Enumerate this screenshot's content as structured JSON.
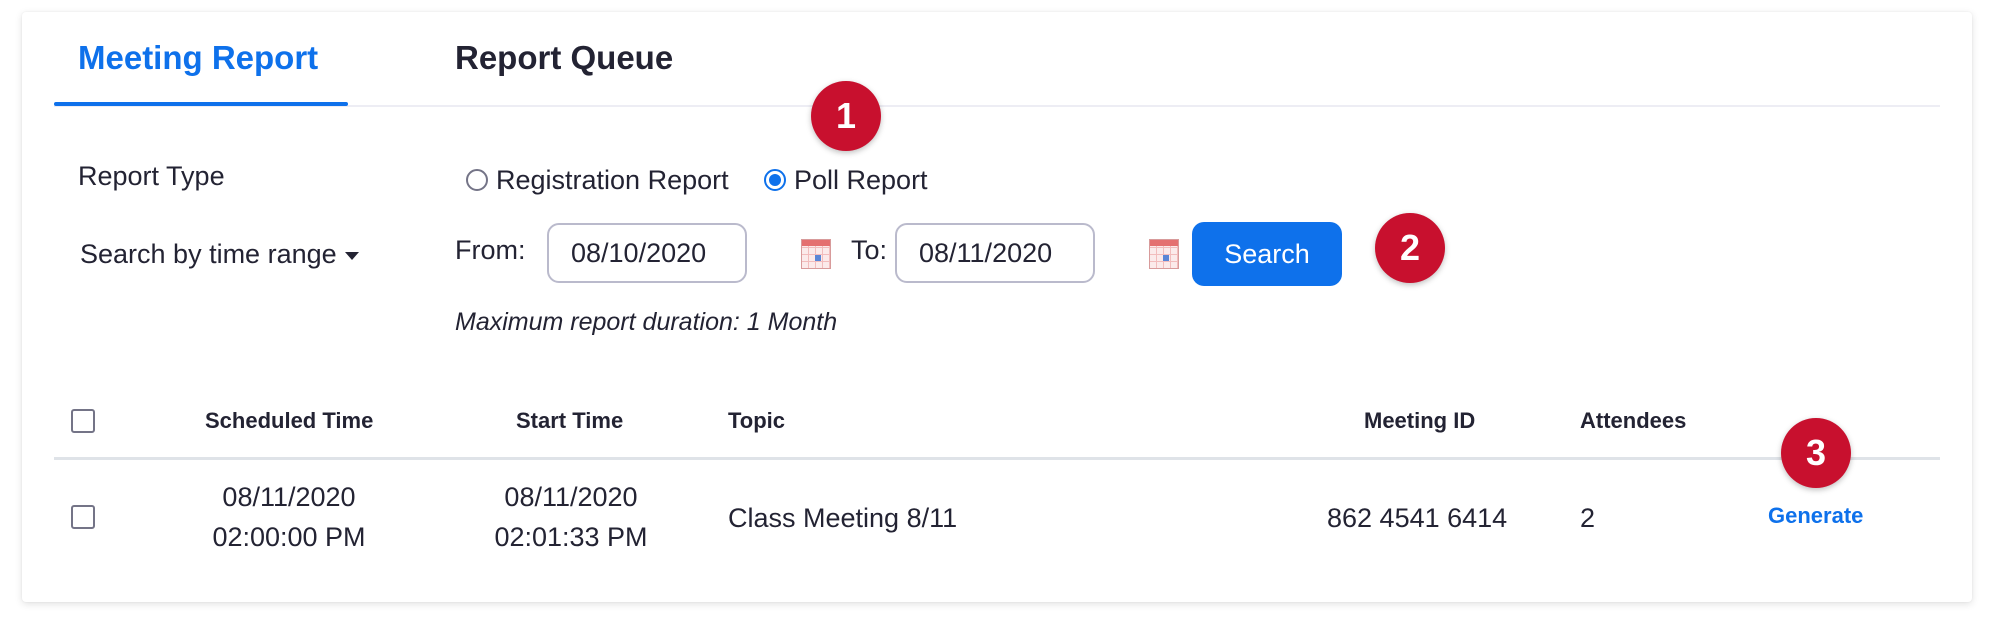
{
  "tabs": [
    {
      "label": "Meeting Report",
      "active": true
    },
    {
      "label": "Report Queue",
      "active": false
    }
  ],
  "report_type": {
    "label": "Report Type",
    "options": [
      {
        "label": "Registration Report",
        "checked": false
      },
      {
        "label": "Poll Report",
        "checked": true
      }
    ]
  },
  "search": {
    "mode_label": "Search by time range",
    "from_label": "From:",
    "from_value": "08/10/2020",
    "to_label": "To:",
    "to_value": "08/11/2020",
    "button_label": "Search",
    "note": "Maximum report duration: 1 Month"
  },
  "table": {
    "headers": [
      "Scheduled Time",
      "Start Time",
      "Topic",
      "Meeting ID",
      "Attendees"
    ],
    "rows": [
      {
        "scheduled_date": "08/11/2020",
        "scheduled_time": "02:00:00 PM",
        "start_date": "08/11/2020",
        "start_time": "02:01:33 PM",
        "topic": "Class Meeting 8/11",
        "meeting_id": "862 4541 6414",
        "attendees": "2",
        "action": "Generate"
      }
    ]
  },
  "annotations": [
    "1",
    "2",
    "3"
  ],
  "colors": {
    "accent": "#0e71eb",
    "badge": "#c8102e",
    "text": "#232333"
  }
}
